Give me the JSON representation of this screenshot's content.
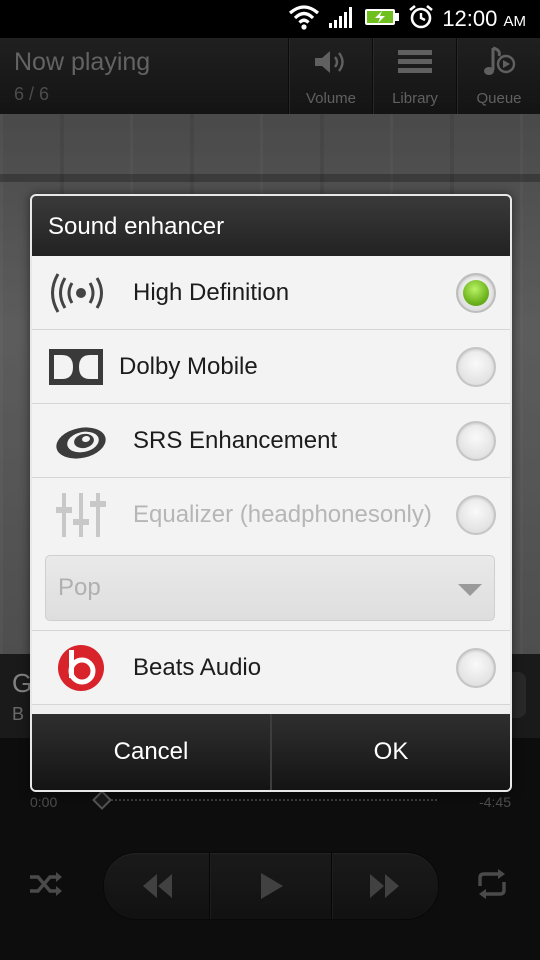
{
  "status_bar": {
    "time": "12:00",
    "ampm": "AM",
    "icons": [
      "wifi-icon",
      "signal-icon",
      "battery-charging-icon",
      "alarm-icon"
    ]
  },
  "action_bar": {
    "title": "Now playing",
    "track_count": "6 / 6",
    "buttons": [
      {
        "label": "Volume",
        "icon": "speaker-icon"
      },
      {
        "label": "Library",
        "icon": "list-icon"
      },
      {
        "label": "Queue",
        "icon": "music-note-play-icon"
      }
    ]
  },
  "now_playing": {
    "song_initial": "G",
    "artist_initial": "B"
  },
  "player": {
    "elapsed": "0:00",
    "remaining": "-4:45",
    "progress": 0.0
  },
  "dialog": {
    "title": "Sound enhancer",
    "options": [
      {
        "label": "High Definition",
        "icon": "high-definition-icon",
        "selected": true,
        "enabled": true
      },
      {
        "label": "Dolby Mobile",
        "icon": "dolby-icon",
        "selected": false,
        "enabled": true
      },
      {
        "label": "SRS Enhancement",
        "icon": "srs-icon",
        "selected": false,
        "enabled": true
      },
      {
        "label": "Equalizer (headphones only)",
        "label_line1": "Equalizer (headphones",
        "label_line2": "only)",
        "icon": "equalizer-icon",
        "selected": false,
        "enabled": false
      },
      {
        "label": "Beats Audio",
        "icon": "beats-icon",
        "selected": false,
        "enabled": true
      }
    ],
    "equalizer_preset": "Pop",
    "cancel_label": "Cancel",
    "ok_label": "OK"
  },
  "colors": {
    "selected_radio": "#7ab82a",
    "beats_red": "#d8232a",
    "dialog_header": "#2a2a2a",
    "dialog_body": "#f3f3f3"
  }
}
